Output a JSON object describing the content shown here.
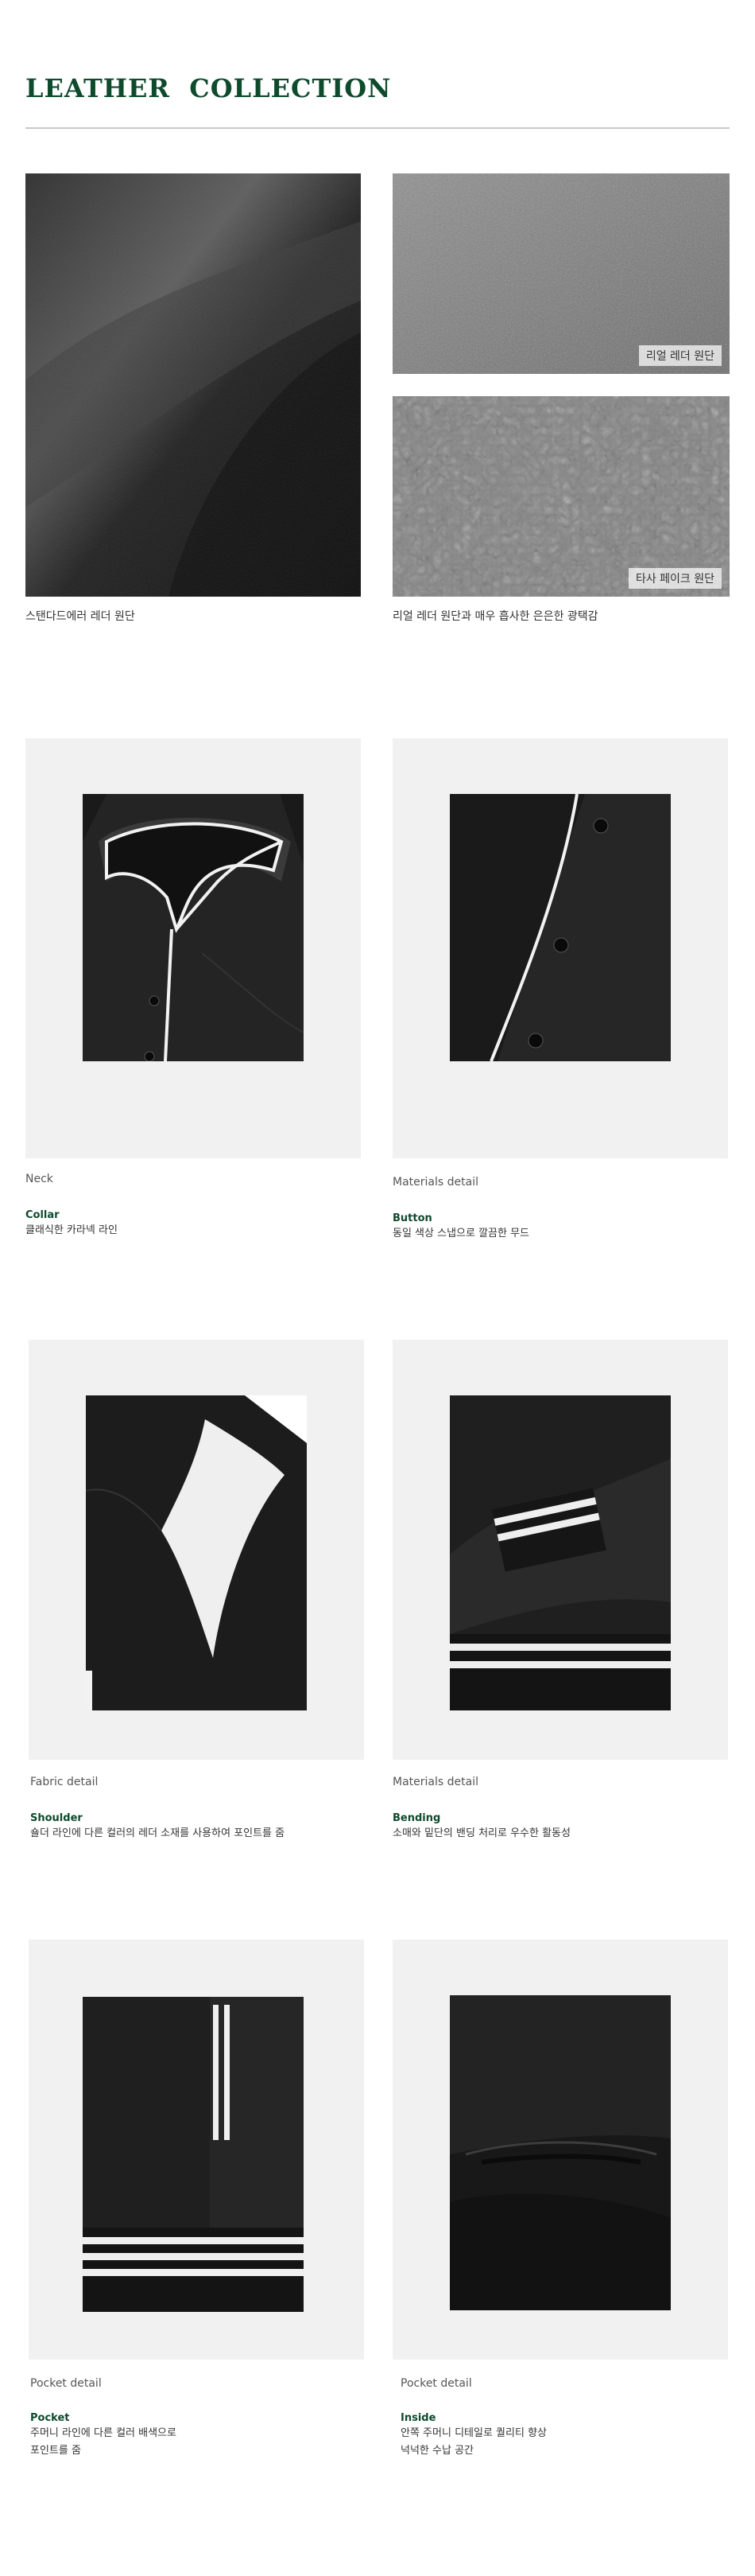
{
  "header": {
    "title": "LEATHER  COLLECTION"
  },
  "fabrics": {
    "standard_caption": "스탠다드에러 레더 원단",
    "real_tag": "리얼 레더 원단",
    "fake_tag": "타사 페이크 원단",
    "compare_caption": "리얼 레더 원단과 매우 흡사한 은은한 광택감"
  },
  "details": [
    {
      "label": "Neck",
      "title": "Collar",
      "lines": [
        "클래식한 카라넥 라인"
      ]
    },
    {
      "label": "Materials detail",
      "title": "Button",
      "lines": [
        "동일 색상 스냅으로 깔끔한 무드"
      ]
    },
    {
      "label": "Fabric detail",
      "title": "Shoulder",
      "lines": [
        "숄더 라인에 다른 컬러의 레더 소재를 사용하여 포인트를 줌"
      ]
    },
    {
      "label": "Materials detail",
      "title": "Bending",
      "lines": [
        "소매와 밑단의 밴딩 처리로 우수한 활동성"
      ]
    },
    {
      "label": "Pocket detail",
      "title": "Pocket",
      "lines": [
        "주머니 라인에 다른 컬러 배색으로",
        "포인트를 줌"
      ]
    },
    {
      "label": "Pocket detail",
      "title": "Inside",
      "lines": [
        "안쪽 주머니 디테일로 퀄리티 향상",
        "넉넉한 수납 공간"
      ]
    }
  ]
}
